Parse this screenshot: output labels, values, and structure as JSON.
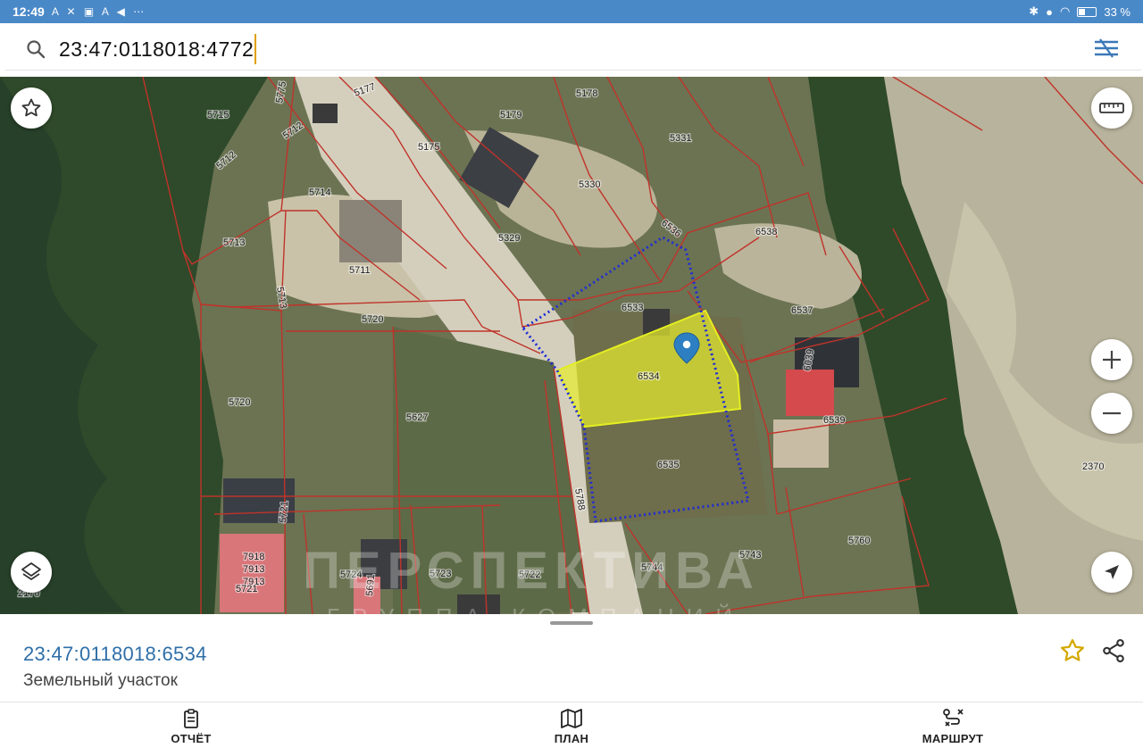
{
  "status_bar": {
    "time": "12:49",
    "notifications": "A ✕ ▣ A ◀ ⋯",
    "battery": "33 %"
  },
  "search": {
    "query": "23:47:0118018:4772"
  },
  "map": {
    "parcel_labels": [
      "5715",
      "5775",
      "5177",
      "5178",
      "5179",
      "5331",
      "5712",
      "5712",
      "5175",
      "5330",
      "6536",
      "5714",
      "5713",
      "5329",
      "6538",
      "5711",
      "6533",
      "6537",
      "5713",
      "5720",
      "6534",
      "6039",
      "6539",
      "5720",
      "5627",
      "6535",
      "2370",
      "5788",
      "5721",
      "5760",
      "7918",
      "7913",
      "7913",
      "5724",
      "5723",
      "5722",
      "5744",
      "5743",
      "5721",
      "5691",
      "2170"
    ],
    "watermark_title": "ПЕРСПЕКТИВА",
    "watermark_subtitle": "ГРУППА КОМПАНИЙ",
    "selection_color": "#e6ec2e",
    "boundary_color": "#1f2bd6",
    "line_color": "#c0332a"
  },
  "sheet": {
    "parcel_number": "23:47:0118018:6534",
    "parcel_type": "Земельный участок"
  },
  "nav": {
    "report_label": "ОТЧЁТ",
    "plan_label": "ПЛАН",
    "route_label": "МАРШРУТ"
  }
}
